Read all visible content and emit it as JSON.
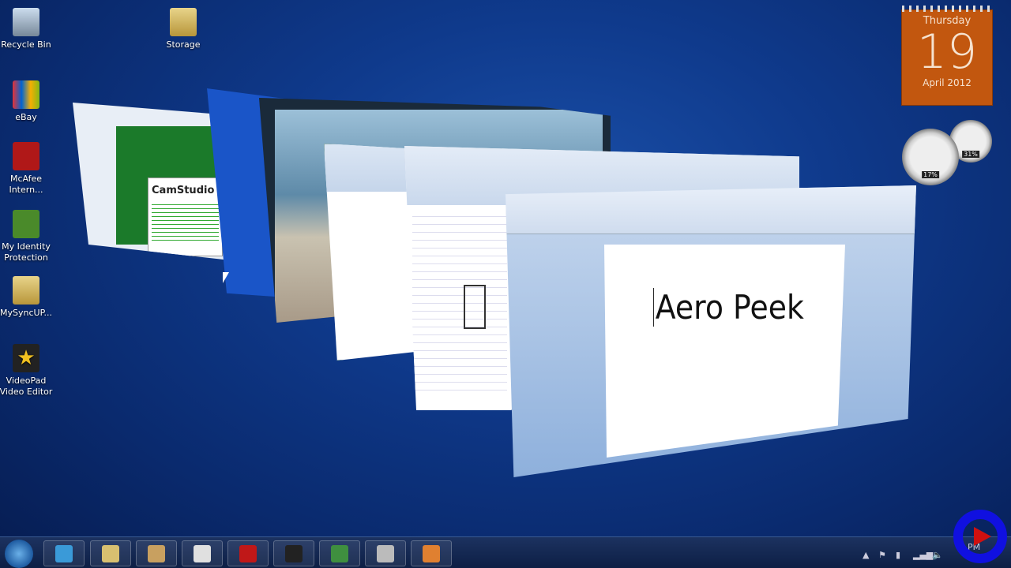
{
  "desktop_icons": [
    {
      "label": "Recycle Bin",
      "icon": "recycle-bin-icon"
    },
    {
      "label": "Storage",
      "icon": "folder-icon"
    },
    {
      "label": "eBay",
      "icon": "ebay-icon"
    },
    {
      "label": "McAfee Intern...",
      "icon": "mcafee-icon"
    },
    {
      "label": "My Identity Protection",
      "icon": "identity-protection-icon"
    },
    {
      "label": "MySyncUP...",
      "icon": "folder-icon"
    },
    {
      "label": "VideoPad Video Editor",
      "icon": "videopad-icon"
    }
  ],
  "calendar": {
    "weekday": "Thursday",
    "day": "19",
    "month_year": "April 2012",
    "color": "#c2570f"
  },
  "gauges": {
    "cpu": "17%",
    "memory": "31%"
  },
  "windows": {
    "camstudio": {
      "title": "CamStudio"
    },
    "word": {
      "document_text": "Aero Peek"
    }
  },
  "taskbar": {
    "items": [
      {
        "name": "internet-explorer",
        "color": "#3a9ad8"
      },
      {
        "name": "file-explorer",
        "color": "#d8c070"
      },
      {
        "name": "paint",
        "color": "#c8a060"
      },
      {
        "name": "wordpad",
        "color": "#e0e0e0"
      },
      {
        "name": "mcafee",
        "color": "#c01818"
      },
      {
        "name": "chess",
        "color": "#222222"
      },
      {
        "name": "excel",
        "color": "#3f8f3f"
      },
      {
        "name": "camstudio",
        "color": "#bbbbbb"
      },
      {
        "name": "media-player",
        "color": "#e08030"
      }
    ],
    "clock": "PM"
  }
}
